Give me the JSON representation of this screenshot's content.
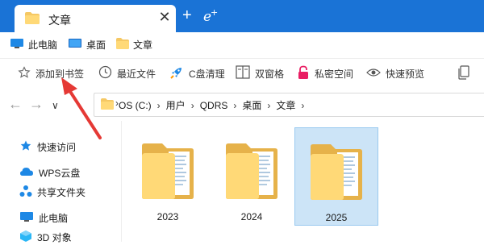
{
  "tab": {
    "title": "文章",
    "close": "✕",
    "new_tab": "+"
  },
  "bookmarks": [
    {
      "label": "此电脑",
      "icon": "pc-icon"
    },
    {
      "label": "桌面",
      "icon": "desktop-icon"
    },
    {
      "label": "文章",
      "icon": "folder-icon"
    }
  ],
  "toolbar": {
    "add_bookmark": "添加到书签",
    "recent_files": "最近文件",
    "c_clean": "C盘清理",
    "dual_pane": "双窗格",
    "private_space": "私密空间",
    "quick_preview": "快速预览"
  },
  "address": {
    "crumbs": [
      "OS (C:)",
      "用户",
      "QDRS",
      "桌面",
      "文章"
    ]
  },
  "sidebar": {
    "items": [
      {
        "label": "快速访问",
        "icon": "star-icon"
      },
      {
        "label": "WPS云盘",
        "icon": "cloud-icon"
      },
      {
        "label": "共享文件夹",
        "icon": "share-icon"
      },
      {
        "label": "此电脑",
        "icon": "pc-icon"
      },
      {
        "label": "3D 对象",
        "icon": "cube-icon"
      }
    ]
  },
  "folders": [
    {
      "name": "2023",
      "selected": false
    },
    {
      "name": "2024",
      "selected": false
    },
    {
      "name": "2025",
      "selected": true
    }
  ],
  "colors": {
    "titlebar": "#1a73d6",
    "folder": "#f5c864",
    "selected_bg": "#cce4f7",
    "arrow": "#e53935"
  }
}
